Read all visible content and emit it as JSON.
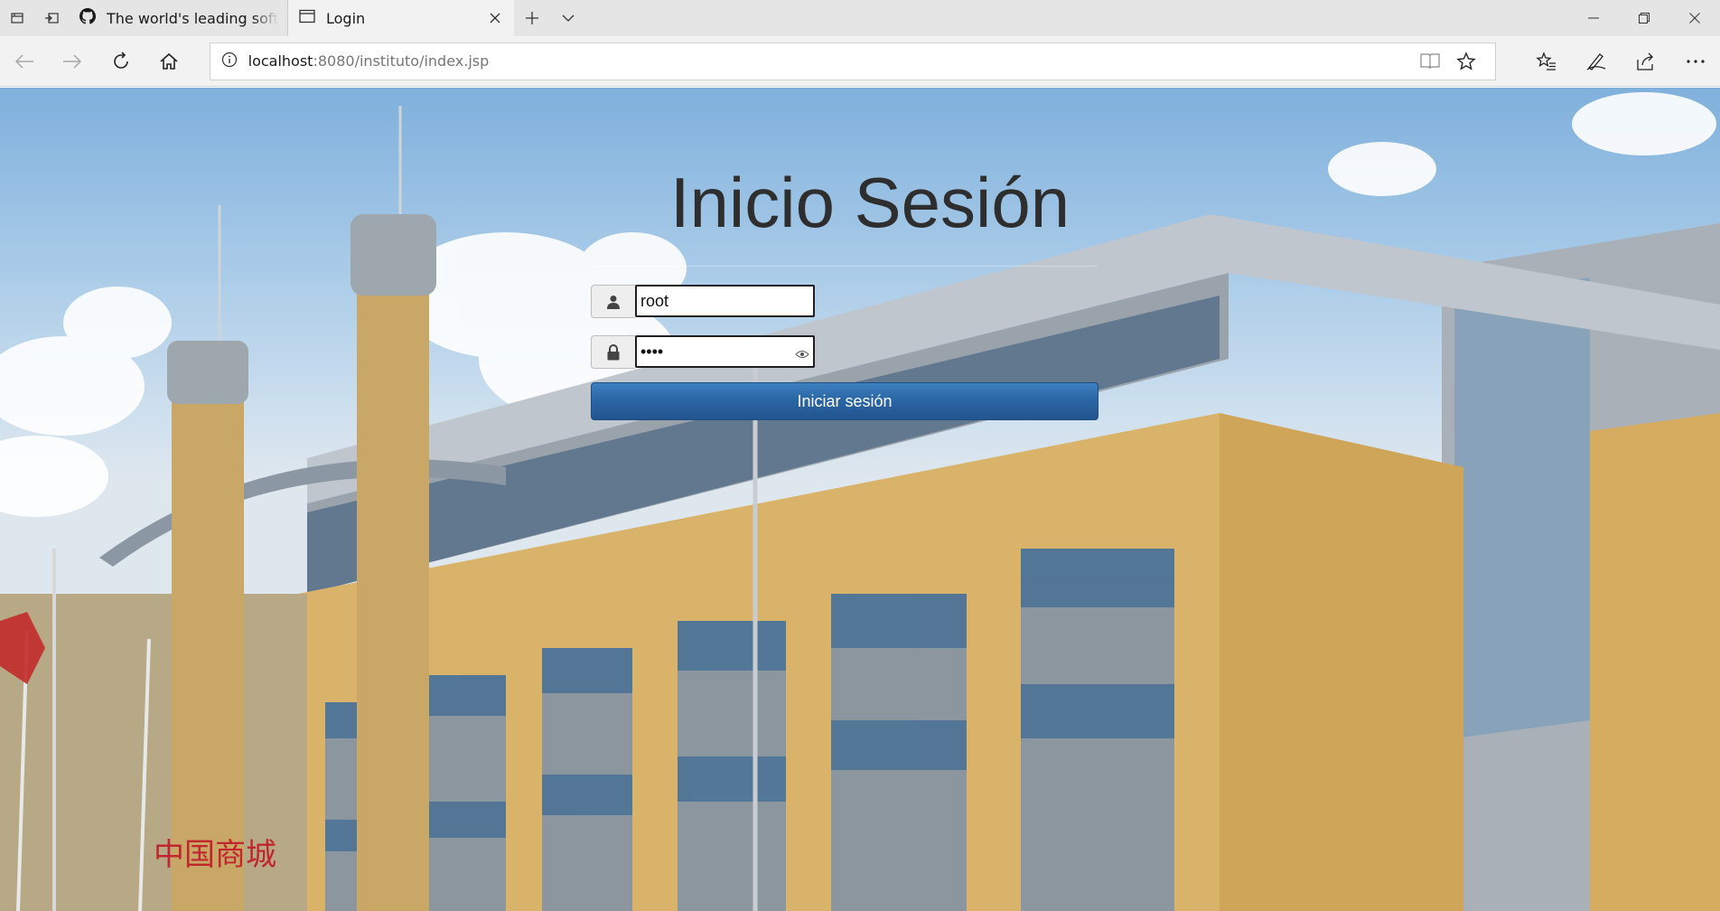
{
  "browser": {
    "tabs": [
      {
        "label": "The world's leading software development platform",
        "active": false,
        "icon": "github-icon"
      },
      {
        "label": "Login",
        "active": true,
        "icon": "page-icon"
      }
    ],
    "address": {
      "host": "localhost",
      "path": ":8080/instituto/index.jsp"
    }
  },
  "login": {
    "title": "Inicio Sesión",
    "username_value": "root",
    "password_value": "root",
    "submit_label": "Iniciar sesión"
  },
  "colors": {
    "button": "#2a66a4",
    "title": "#2e2e2e",
    "chrome": "#f2f2f2"
  }
}
